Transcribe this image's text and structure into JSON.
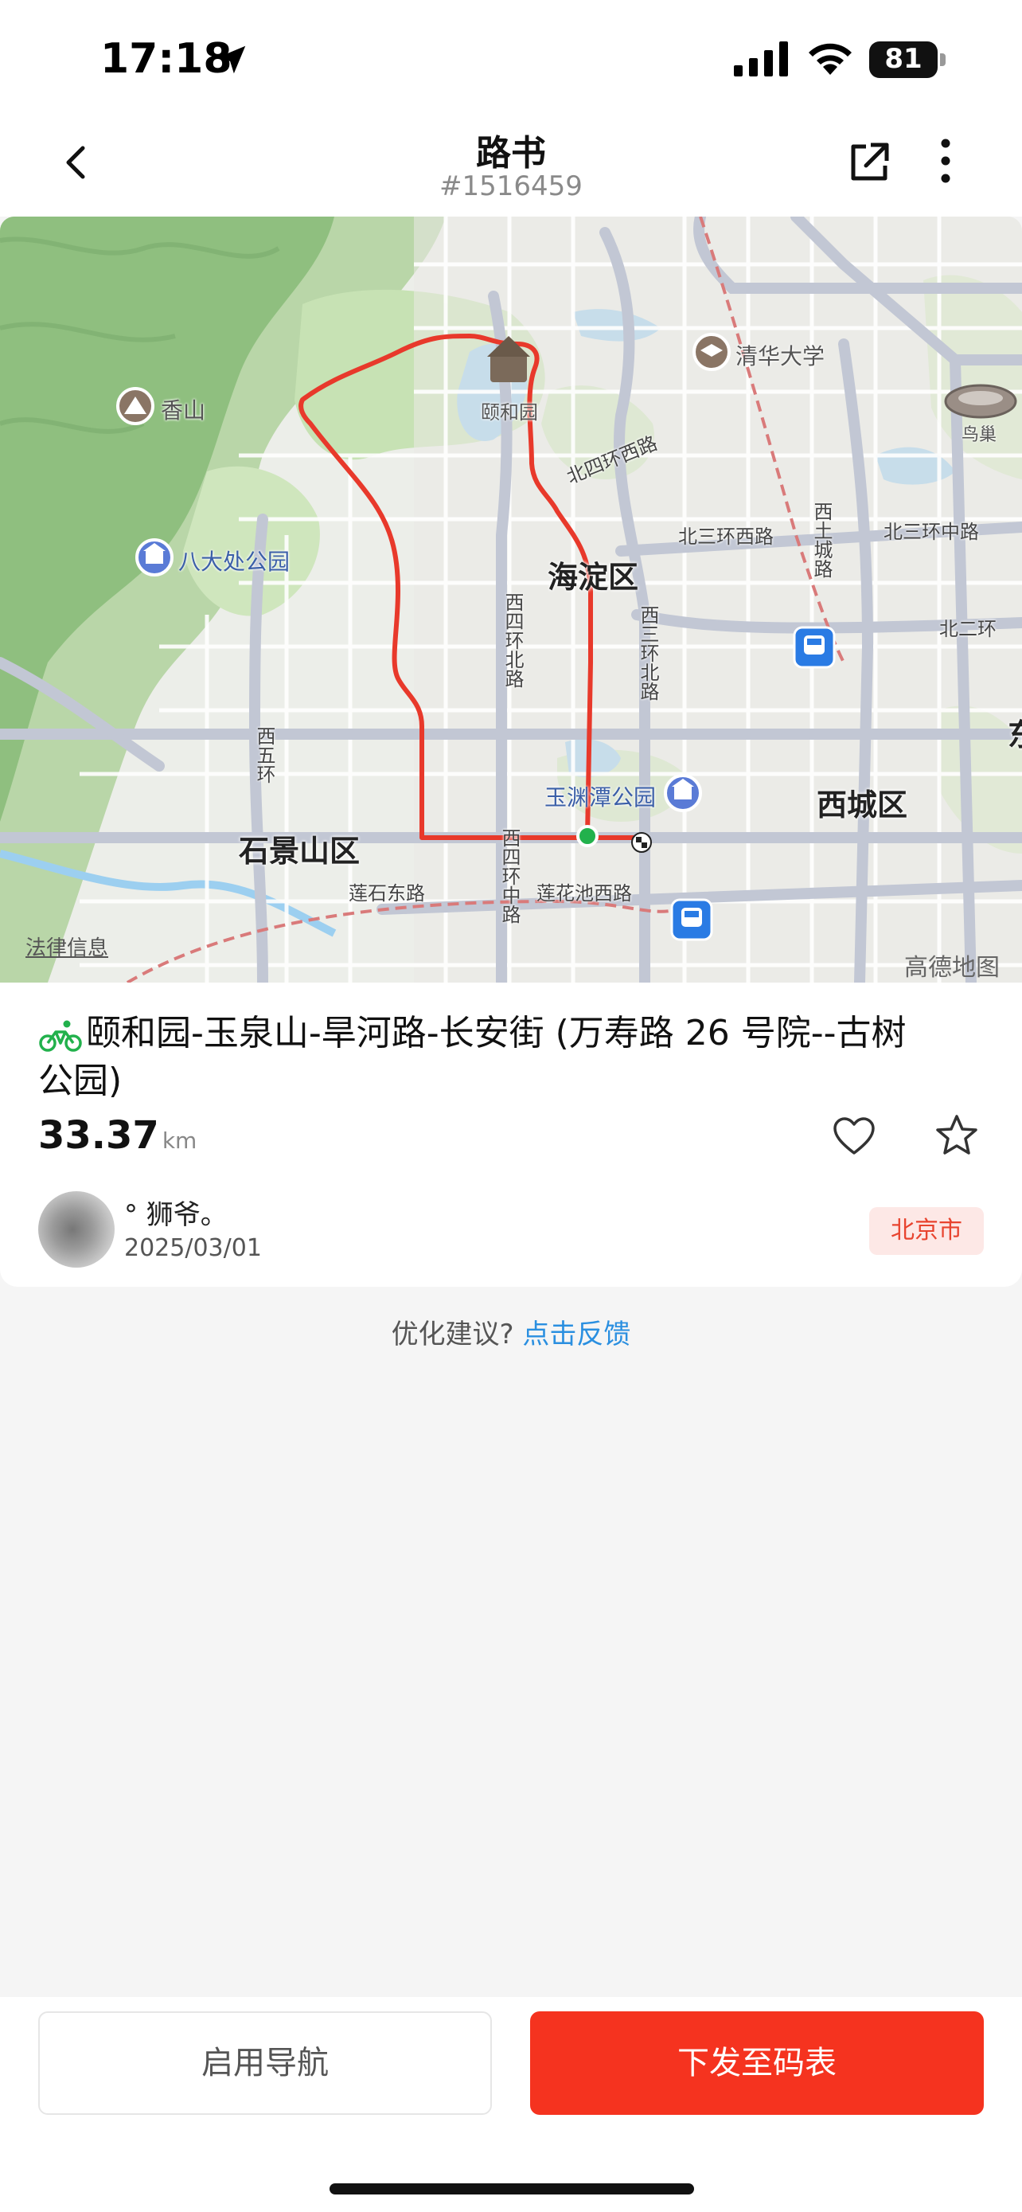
{
  "status_bar": {
    "time": "17:18",
    "battery": "81"
  },
  "header": {
    "title": "路书",
    "route_id": "#1516459"
  },
  "map": {
    "districts": [
      "海淀区",
      "西城区",
      "石景山区"
    ],
    "pois": [
      "香山",
      "颐和园",
      "清华大学",
      "八大处公园",
      "玉渊潭公园",
      "鸟巢"
    ],
    "roads": [
      "北四环西路",
      "北三环西路",
      "北三环中路",
      "北二环",
      "西四环北路",
      "西三环北路",
      "西五环",
      "莲石东路",
      "西四环中路",
      "莲花池西路",
      "西土城路"
    ],
    "legal_link": "法律信息",
    "provider": "高德地图",
    "edge_char": "东"
  },
  "route": {
    "title": "颐和园-玉泉山-旱河路-长安街 (万寿路 26 号院--古树公园)",
    "distance": "33.37",
    "distance_unit": "km",
    "author": "° 狮爷。",
    "date": "2025/03/01",
    "city": "北京市"
  },
  "feedback": {
    "prompt": "优化建议?",
    "link": "点击反馈"
  },
  "actions": {
    "navigate": "启用导航",
    "send": "下发至码表"
  },
  "colors": {
    "accent": "#f5331f",
    "route_line": "#e8392b",
    "link": "#2a8fe0",
    "start_dot": "#22b14c"
  }
}
